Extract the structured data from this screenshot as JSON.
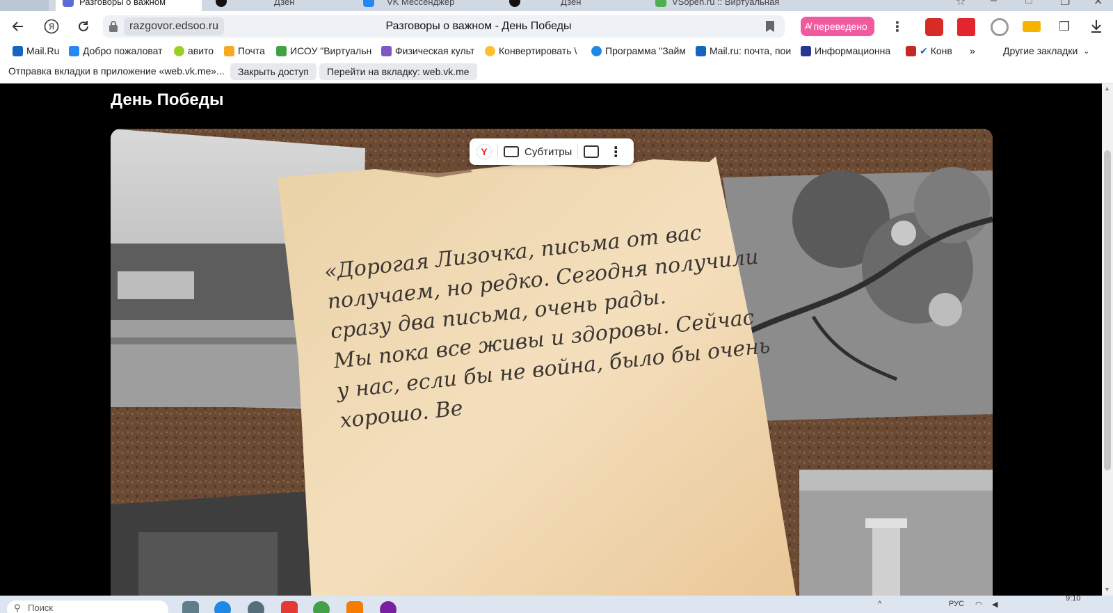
{
  "tabs": [
    {
      "label": "Разговоры о важном",
      "active": true
    },
    {
      "label": "Дзен",
      "active": false
    },
    {
      "label": "VK Мессенджер",
      "active": false
    },
    {
      "label": "Дзен",
      "active": false
    },
    {
      "label": "VSopen.ru :: Виртуальная",
      "active": false
    }
  ],
  "omnibox": {
    "domain": "razgovor.edsoo.ru",
    "page_title": "Разговоры о важном - День Победы"
  },
  "translate_badge": "переведено",
  "bookmarks": [
    "Mail.Ru",
    "Добро пожаловат",
    "авито",
    "Почта",
    "ИСОУ \"Виртуальн",
    "Физическая культ",
    "Конвертировать \\",
    "Программа \"Займ",
    "Mail.ru: почта, пои",
    "Информационна",
    "Конв"
  ],
  "bookmarks_more": "»",
  "other_bookmarks": "Другие закладки",
  "notification": {
    "text": "Отправка вкладки в приложение «web.vk.me»...",
    "btn_close": "Закрыть доступ",
    "btn_goto": "Перейти на вкладку: web.vk.me"
  },
  "page": {
    "heading": "День Победы"
  },
  "video_controls": {
    "subtitles_label": "Субтитры"
  },
  "letter_lines": [
    "«Дорогая Лизочка, письма от вас",
    "получаем, но редко. Сегодня получили",
    "сразу два письма, очень рады.",
    "Мы пока все живы и здоровы. Сейчас",
    "у нас, если бы не война, было бы очень",
    "хорошо. Ве"
  ],
  "taskbar": {
    "search_placeholder": "Поиск",
    "lang": "РУС",
    "time": "9:10"
  },
  "colors": {
    "translate_pink": "#f05b9f",
    "page_bg": "#000000",
    "toolbar_bg": "#ffffff",
    "tabstrip_bg": "#cfd8e3",
    "parchment": "#f1d9b2"
  }
}
